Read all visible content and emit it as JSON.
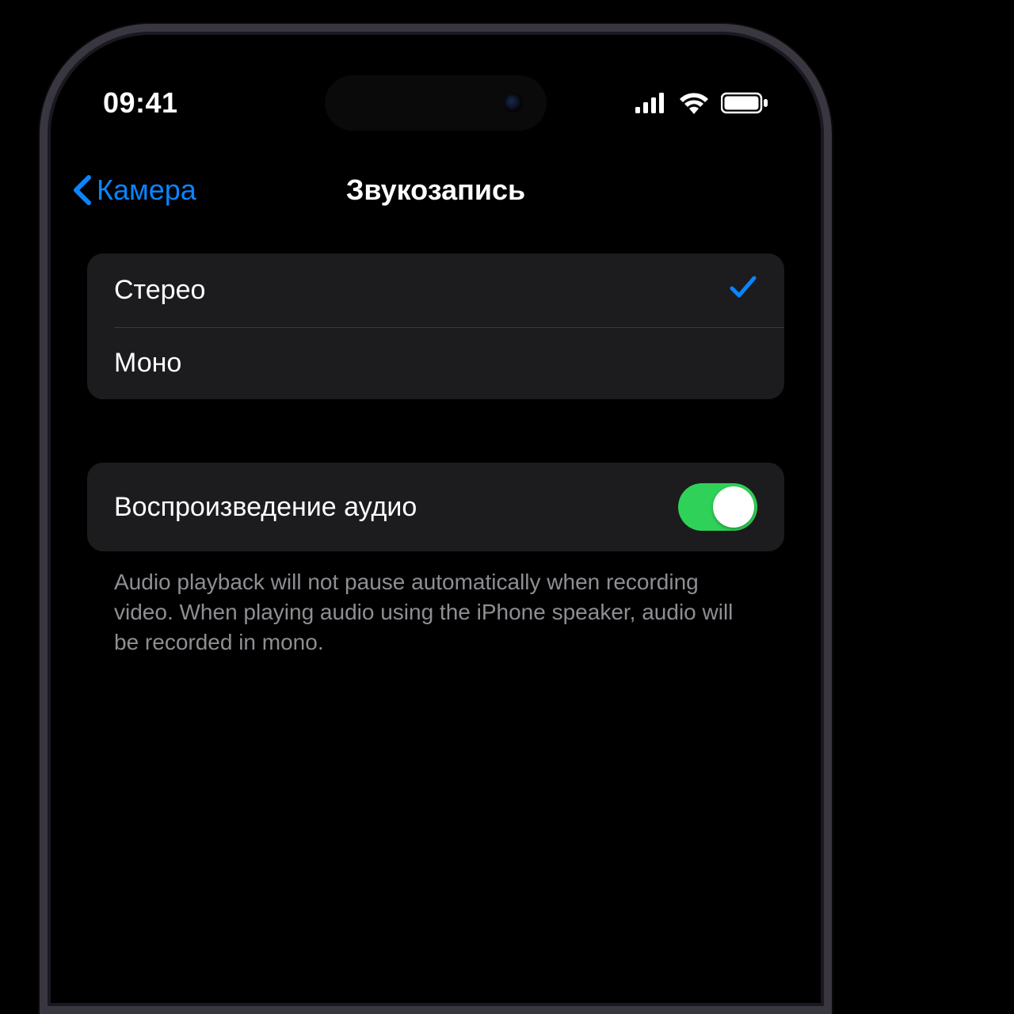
{
  "status": {
    "time": "09:41"
  },
  "nav": {
    "back_label": "Камера",
    "title": "Звукозапись"
  },
  "options": {
    "stereo": {
      "label": "Стерео",
      "selected": true
    },
    "mono": {
      "label": "Моно",
      "selected": false
    }
  },
  "playback": {
    "label": "Воспроизведение аудио",
    "enabled": true,
    "footer": "Audio playback will not pause automatically when recording video. When playing audio using the iPhone speaker, audio will be recorded in mono."
  },
  "colors": {
    "accent": "#0a84ff",
    "toggle_on": "#30d158",
    "cell_bg": "#1c1c1e",
    "secondary_text": "#8e8e93"
  }
}
